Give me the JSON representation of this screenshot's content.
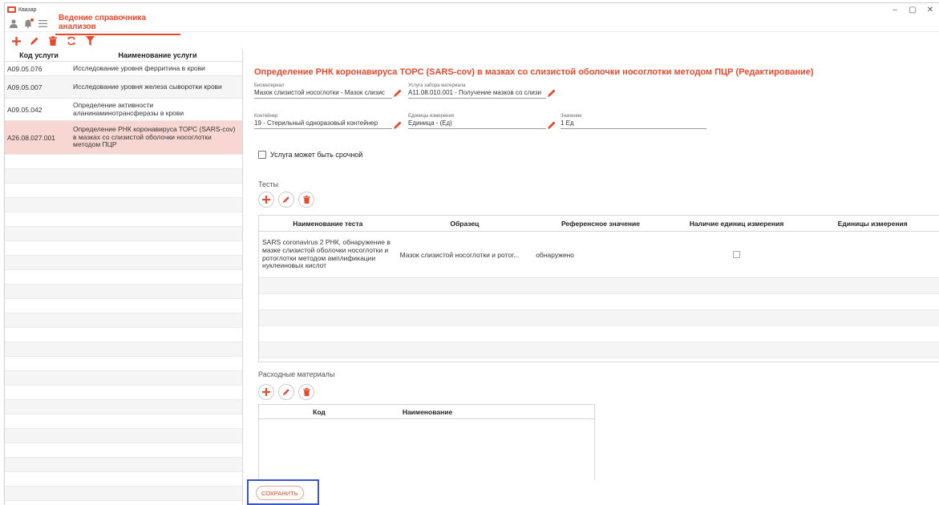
{
  "app": {
    "title": "Квазар"
  },
  "window": {
    "minimize": "–",
    "maximize": "▢",
    "close": "✕"
  },
  "nav": {
    "active_tab": "Ведение справочника анализов"
  },
  "colors": {
    "accent": "#e64a2e",
    "selected_row": "#f8d7d2",
    "focus_outline": "#3a56c7"
  },
  "left_table": {
    "col_code": "Код услуги",
    "col_name": "Наименование услуги",
    "rows": [
      {
        "code": "A09.05.076",
        "name": "Исследование уровня ферритина в крови"
      },
      {
        "code": "A09.05.007",
        "name": "Исследование уровня железа сыворотки крови"
      },
      {
        "code": "A09.05.042",
        "name": "Определение активности аланинаминотрансферазы в крови"
      },
      {
        "code": "A26.08.027.001",
        "name": "Определение РНК коронавируса ТОРС (SARS-cov) в мазках со слизистой оболочки носоглотки методом ПЦР"
      }
    ]
  },
  "editor": {
    "title": "Определение РНК коронавируса ТОРС (SARS-cov) в мазках со слизистой оболочки носоглотки методом ПЦР (Редактирование)",
    "biomaterial_label": "Биоматериал",
    "biomaterial_value": "Мазок слизистой носоглотки - Мазок слизис",
    "service_label": "Услуга забора материала",
    "service_value": "A11.08.010.001 - Получение мазков со слизи",
    "container_label": "Контейнер",
    "container_value": "19 - Стерильный одноразовый контейнер",
    "units_label": "Единицы измерения",
    "units_value": "Единица - (Ед)",
    "value_label": "Значение",
    "value_value": "1 Ед",
    "urgent_label": "Услуга может быть срочной",
    "tests_label": "Тесты",
    "materials_label": "Расходные материалы",
    "save_label": "СОХРАНИТЬ"
  },
  "tests_table": {
    "headers": [
      "Наименование теста",
      "Образец",
      "Референсное значение",
      "Наличие единиц измерения",
      "Единицы измерения"
    ],
    "rows": [
      {
        "name": "SARS coronavirus 2 РНК, обнаружение в мазке слизистой оболочки носоглотки и ротоглотки методом амплификации нуклеиновых кислот",
        "sample": "Мазок слизистой носоглотки и ротог...",
        "reference": "обнаружено",
        "units": ""
      }
    ]
  },
  "materials_table": {
    "headers": [
      "Код",
      "Наименование"
    ]
  }
}
